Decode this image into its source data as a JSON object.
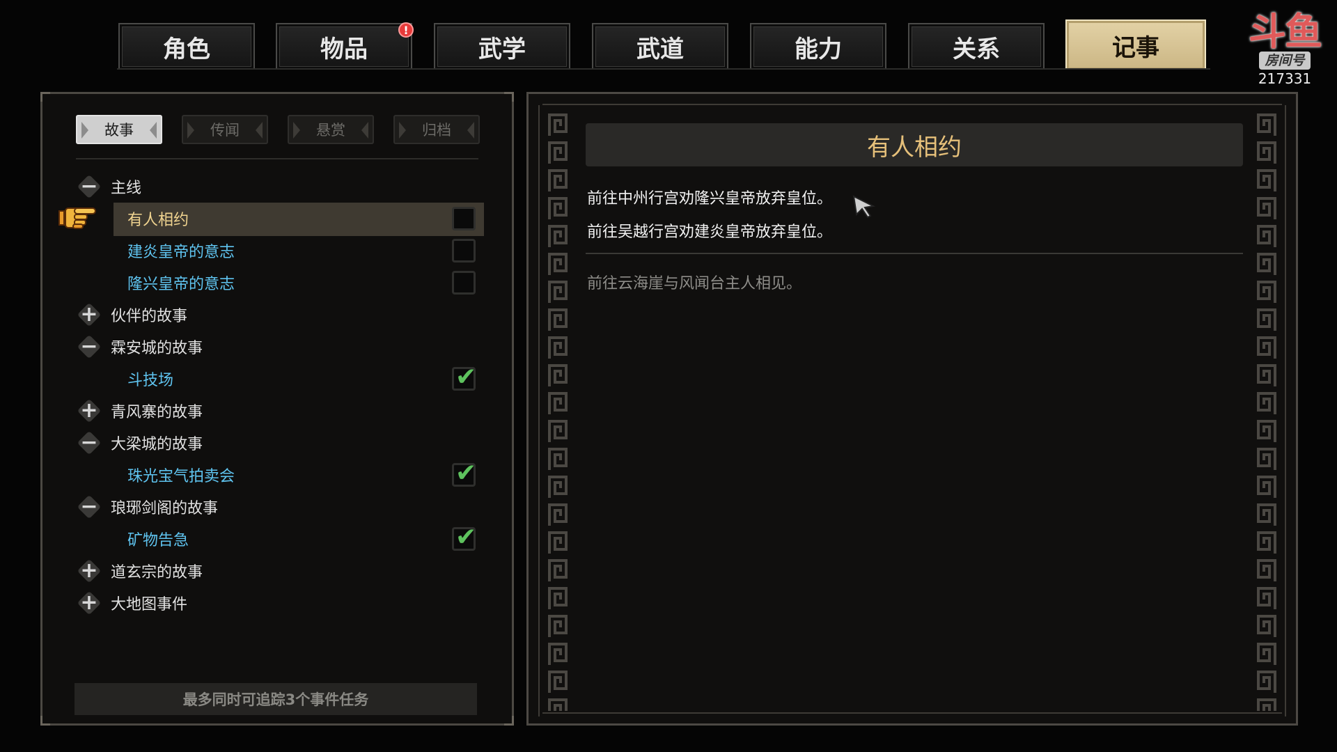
{
  "top_tabs": [
    {
      "label": "角色"
    },
    {
      "label": "物品",
      "badge": "!"
    },
    {
      "label": "武学"
    },
    {
      "label": "武道"
    },
    {
      "label": "能力"
    },
    {
      "label": "关系"
    },
    {
      "label": "记事",
      "active": true
    }
  ],
  "watermark": {
    "logo": "斗鱼",
    "label": "房间号",
    "room": "217331"
  },
  "sub_tabs": [
    {
      "label": "故事",
      "active": true
    },
    {
      "label": "传闻"
    },
    {
      "label": "悬赏"
    },
    {
      "label": "归档"
    }
  ],
  "tree": {
    "main": {
      "label": "主线",
      "expanded": true
    },
    "main_items": [
      {
        "label": "有人相约",
        "selected": true,
        "tracked": false
      },
      {
        "label": "建炎皇帝的意志",
        "tracked": false
      },
      {
        "label": "隆兴皇帝的意志",
        "tracked": false
      }
    ],
    "companion": {
      "label": "伙伴的故事",
      "expanded": false
    },
    "linan": {
      "label": "霖安城的故事",
      "expanded": true
    },
    "linan_items": [
      {
        "label": "斗技场",
        "tracked": true
      }
    ],
    "qingfeng": {
      "label": "青风寨的故事",
      "expanded": false
    },
    "daliang": {
      "label": "大梁城的故事",
      "expanded": true
    },
    "daliang_items": [
      {
        "label": "珠光宝气拍卖会",
        "tracked": true
      }
    ],
    "langya": {
      "label": "琅琊剑阁的故事",
      "expanded": true
    },
    "langya_items": [
      {
        "label": "矿物告急",
        "tracked": true
      }
    ],
    "daoxuan": {
      "label": "道玄宗的故事",
      "expanded": false
    },
    "worldmap": {
      "label": "大地图事件",
      "expanded": false
    }
  },
  "footer_note": "最多同时可追踪3个事件任务",
  "detail": {
    "title": "有人相约",
    "objectives": [
      "前往中州行宫劝隆兴皇帝放弃皇位。",
      "前往吴越行宫劝建炎皇帝放弃皇位。"
    ],
    "completed_objectives": [
      "前往云海崖与风闻台主人相见。"
    ]
  },
  "icons": {
    "expand": "plus-icon",
    "collapse": "minus-icon",
    "check": "checkmark-icon",
    "pointer": "pointing-hand-icon"
  },
  "colors": {
    "active_tab": "#d8c495",
    "quest_title": "#e6c07a",
    "child_item": "#5fc4f0",
    "selected_item": "#f0d490",
    "check": "#5ec25e"
  }
}
